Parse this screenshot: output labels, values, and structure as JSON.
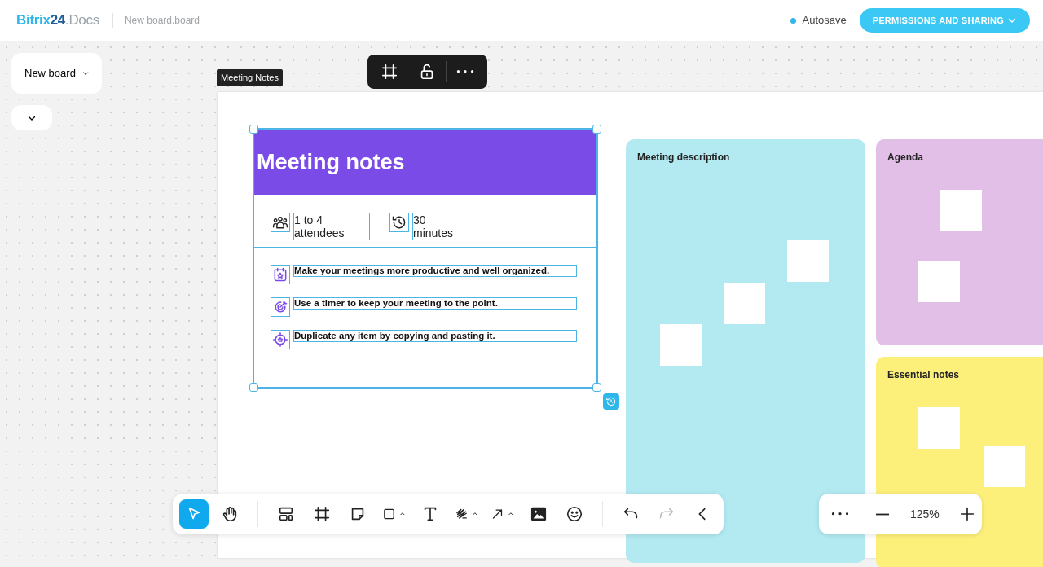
{
  "header": {
    "logo": [
      "Bitrix",
      "24",
      ".Docs"
    ],
    "file_name": "New board.board",
    "autosave": {
      "label": "Autosave",
      "on": true
    },
    "share_button": "PERMISSIONS AND SHARING"
  },
  "board_menu": {
    "label": "New board"
  },
  "object_label": "Meeting Notes",
  "object_toolbar": [
    {
      "kind": "frame"
    },
    {
      "kind": "unlock"
    },
    {
      "kind": "more"
    }
  ],
  "widget": {
    "title": "Meeting notes",
    "info": [
      {
        "kind": "people",
        "text": "1 to 4 attendees"
      },
      {
        "kind": "clock",
        "text": "30 minutes"
      }
    ],
    "tips": [
      {
        "kind": "calendar",
        "text": "Make your meetings more productive and well organized."
      },
      {
        "kind": "target",
        "text": "Use a timer to keep your meeting to the point."
      },
      {
        "kind": "crosshair",
        "text": "Duplicate any item by copying and pasting it."
      }
    ]
  },
  "frames": [
    {
      "title": "Meeting description",
      "color": "#b3eaf2"
    },
    {
      "title": "Agenda",
      "color": "#e1bfe6"
    },
    {
      "title": "Essential notes",
      "color": "#fdf07a"
    }
  ],
  "tools": [
    {
      "kind": "select",
      "selected": true,
      "caret": false,
      "disabled": false
    },
    {
      "kind": "hand",
      "selected": false,
      "caret": false,
      "disabled": false
    },
    {
      "kind": "sep"
    },
    {
      "kind": "layout",
      "selected": false,
      "caret": false,
      "disabled": false
    },
    {
      "kind": "frame",
      "selected": false,
      "caret": false,
      "disabled": false
    },
    {
      "kind": "sticky",
      "selected": false,
      "caret": false,
      "disabled": false
    },
    {
      "kind": "shape",
      "selected": false,
      "caret": true,
      "disabled": false
    },
    {
      "kind": "text",
      "selected": false,
      "caret": false,
      "disabled": false
    },
    {
      "kind": "pen",
      "selected": false,
      "caret": true,
      "disabled": false
    },
    {
      "kind": "arrow",
      "selected": false,
      "caret": true,
      "disabled": false
    },
    {
      "kind": "image",
      "selected": false,
      "caret": false,
      "disabled": false
    },
    {
      "kind": "emoji",
      "selected": false,
      "caret": false,
      "disabled": false
    },
    {
      "kind": "sep"
    },
    {
      "kind": "undo",
      "selected": false,
      "caret": false,
      "disabled": false
    },
    {
      "kind": "redo",
      "selected": false,
      "caret": false,
      "disabled": true
    },
    {
      "kind": "collapse",
      "selected": false,
      "caret": false,
      "disabled": false
    }
  ],
  "zoom": {
    "level_text": "125%"
  }
}
